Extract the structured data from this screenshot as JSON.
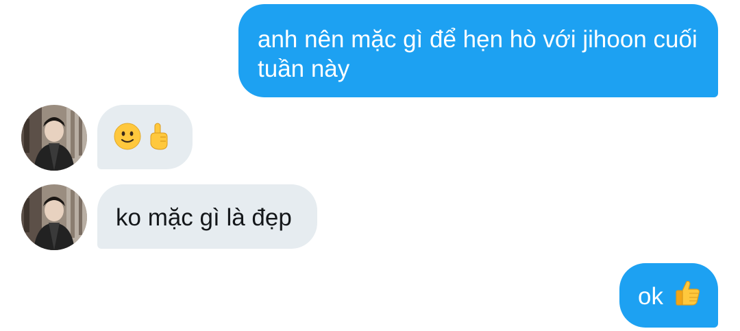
{
  "conversation": {
    "messages": [
      {
        "direction": "outgoing",
        "text": "anh nên mặc gì để hẹn hò với jihoon cuối tuần này"
      },
      {
        "direction": "incoming",
        "text": "",
        "emojis": [
          "slightly-smiling-face",
          "pointing-up-finger"
        ]
      },
      {
        "direction": "incoming",
        "text": "ko mặc gì là đẹp"
      },
      {
        "direction": "outgoing",
        "text": "ok",
        "emojis": [
          "thumbs-up"
        ]
      }
    ]
  },
  "colors": {
    "outgoing_bubble": "#1da1f2",
    "incoming_bubble": "#e6ecf0",
    "outgoing_text": "#ffffff",
    "incoming_text": "#14171a",
    "emoji_yellow": "#ffc83d"
  },
  "avatar": {
    "icon": "user-avatar-photo"
  }
}
